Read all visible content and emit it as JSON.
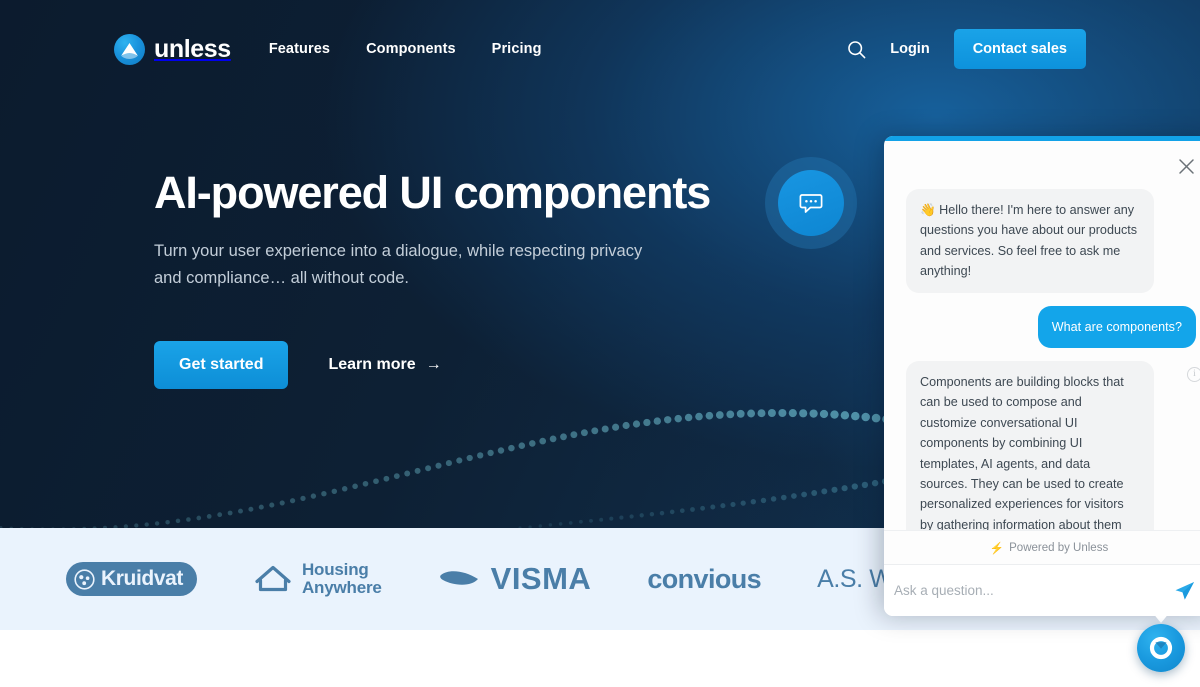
{
  "brand": {
    "name": "unless",
    "logo_icon": "unless-logo-icon"
  },
  "nav": {
    "links": [
      {
        "label": "Features"
      },
      {
        "label": "Components"
      },
      {
        "label": "Pricing"
      }
    ],
    "search_icon": "search-icon",
    "login_label": "Login",
    "contact_label": "Contact sales"
  },
  "hero": {
    "headline": "AI-powered UI components",
    "subhead": "Turn your user experience into a dialogue, while respecting privacy and compliance… all without code.",
    "primary_cta": "Get started",
    "secondary_cta": "Learn more",
    "secondary_arrow": "→",
    "decoration_icon": "chat-bubble-icon"
  },
  "logos": [
    {
      "name": "partner-logo-partial",
      "label": ""
    },
    {
      "name": "kruidvat",
      "label": "Kruidvat"
    },
    {
      "name": "housing-anywhere",
      "label_line1": "Housing",
      "label_line2": "Anywhere"
    },
    {
      "name": "visma",
      "label": "VISMA"
    },
    {
      "name": "convious",
      "label": "convious"
    },
    {
      "name": "as-watson-group",
      "label": "A.S. Watson Group"
    }
  ],
  "chat": {
    "close_icon": "close-icon",
    "info_icon": "info-icon",
    "messages": [
      {
        "from": "bot",
        "text": "👋 Hello there! I'm here to answer any questions you have about our products and services. So feel free to ask me anything!"
      },
      {
        "from": "user",
        "text": "What are components?"
      },
      {
        "from": "bot",
        "text": "Components are building blocks that can be used to compose and customize conversational UI components by combining UI templates, AI agents, and data sources. They can be used to create personalized experiences for visitors by gathering information about them and grouping them into audiences."
      }
    ],
    "powered_by": "Powered by Unless",
    "powered_icon": "⚡",
    "input_placeholder": "Ask a question...",
    "input_value": "",
    "send_icon": "send-icon",
    "launcher_icon": "unless-chat-launcher-icon"
  },
  "colors": {
    "accent_blue": "#12a2e8",
    "hero_dark": "#0c1b2e",
    "logo_strip_bg": "#eaf3fd",
    "logo_ink": "#4a7ea8",
    "bot_bubble": "#f2f3f4",
    "user_bubble": "#13a5ea"
  }
}
